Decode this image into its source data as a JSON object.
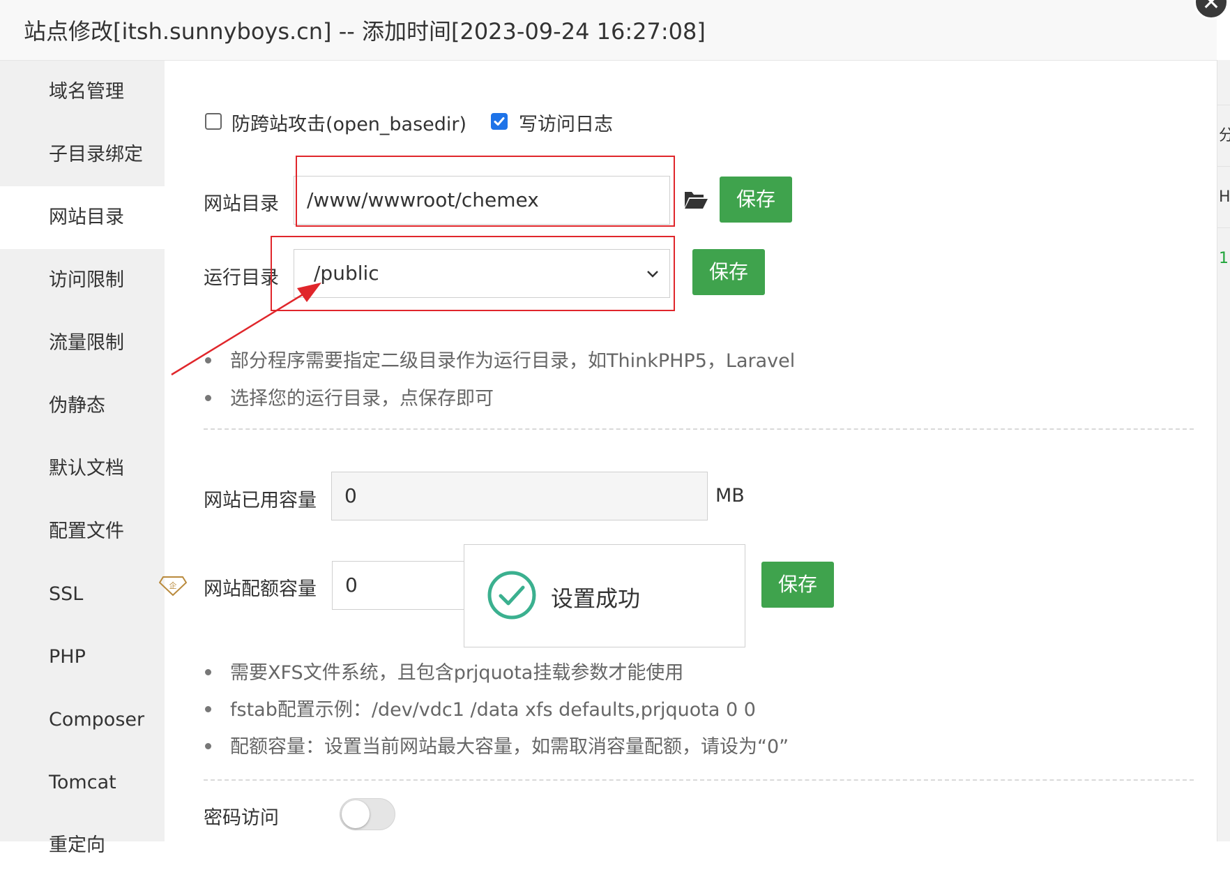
{
  "window": {
    "title": "站点修改[itsh.sunnyboys.cn] -- 添加时间[2023-09-24 16:27:08]",
    "close_glyph": "✕"
  },
  "right_strip": {
    "cells": [
      "分",
      "HP",
      "1"
    ]
  },
  "sidebar": {
    "items": [
      {
        "label": "域名管理",
        "active": false
      },
      {
        "label": "子目录绑定",
        "active": false
      },
      {
        "label": "网站目录",
        "active": true
      },
      {
        "label": "访问限制",
        "active": false
      },
      {
        "label": "流量限制",
        "active": false
      },
      {
        "label": "伪静态",
        "active": false
      },
      {
        "label": "默认文档",
        "active": false
      },
      {
        "label": "配置文件",
        "active": false
      },
      {
        "label": "SSL",
        "active": false
      },
      {
        "label": "PHP",
        "active": false
      },
      {
        "label": "Composer",
        "active": false
      },
      {
        "label": "Tomcat",
        "active": false
      },
      {
        "label": "重定向",
        "active": false
      }
    ]
  },
  "options": {
    "open_basedir": {
      "label": "防跨站攻击(open_basedir)",
      "checked": false
    },
    "access_log": {
      "label": "写访问日志",
      "checked": true
    }
  },
  "site_dir": {
    "label": "网站目录",
    "value": "/www/wwwroot/chemex",
    "save_label": "保存"
  },
  "run_dir": {
    "label": "运行目录",
    "value": "/public",
    "save_label": "保存"
  },
  "run_dir_tips": [
    "部分程序需要指定二级目录作为运行目录，如ThinkPHP5，Laravel",
    "选择您的运行目录，点保存即可"
  ],
  "used_capacity": {
    "label": "网站已用容量",
    "value": "0",
    "unit": "MB"
  },
  "quota_capacity": {
    "label": "网站配额容量",
    "badge": "企",
    "value": "0",
    "save_label": "保存"
  },
  "toast": {
    "message": "设置成功"
  },
  "quota_tips": [
    "需要XFS文件系统，且包含prjquota挂载参数才能使用",
    "fstab配置示例：/dev/vdc1 /data xfs defaults,prjquota 0 0",
    "配额容量：设置当前网站最大容量，如需取消容量配额，请设为“0”"
  ],
  "password_access": {
    "label": "密码访问",
    "enabled": false
  },
  "colors": {
    "accent_green": "#3fa34d",
    "checkbox_blue": "#1e73e8",
    "annotation_red": "#e0262b",
    "success_teal": "#3bb08f"
  }
}
